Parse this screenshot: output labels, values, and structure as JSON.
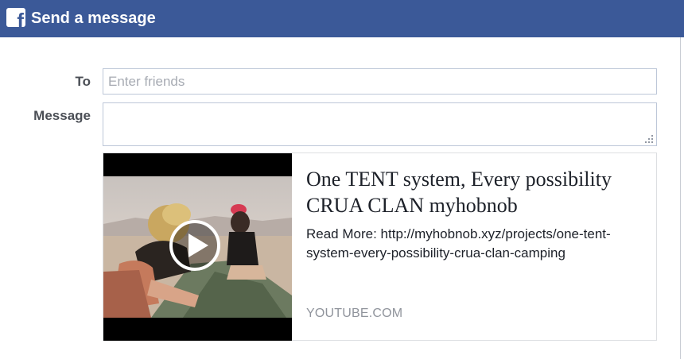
{
  "dialog": {
    "title": "Send a message",
    "logo_letter": "f",
    "header_color": "#3b5998"
  },
  "form": {
    "to_label": "To",
    "to_placeholder": "Enter friends",
    "to_value": "",
    "message_label": "Message",
    "message_value": ""
  },
  "preview": {
    "title": "One TENT system, Every possibility CRUA CLAN myhobnob",
    "description": "Read More: http://myhobnob.xyz/projects/one-tent-system-every-possibility-crua-clan-camping",
    "domain": "YOUTUBE.COM",
    "thumbnail_icon": "play-icon"
  }
}
